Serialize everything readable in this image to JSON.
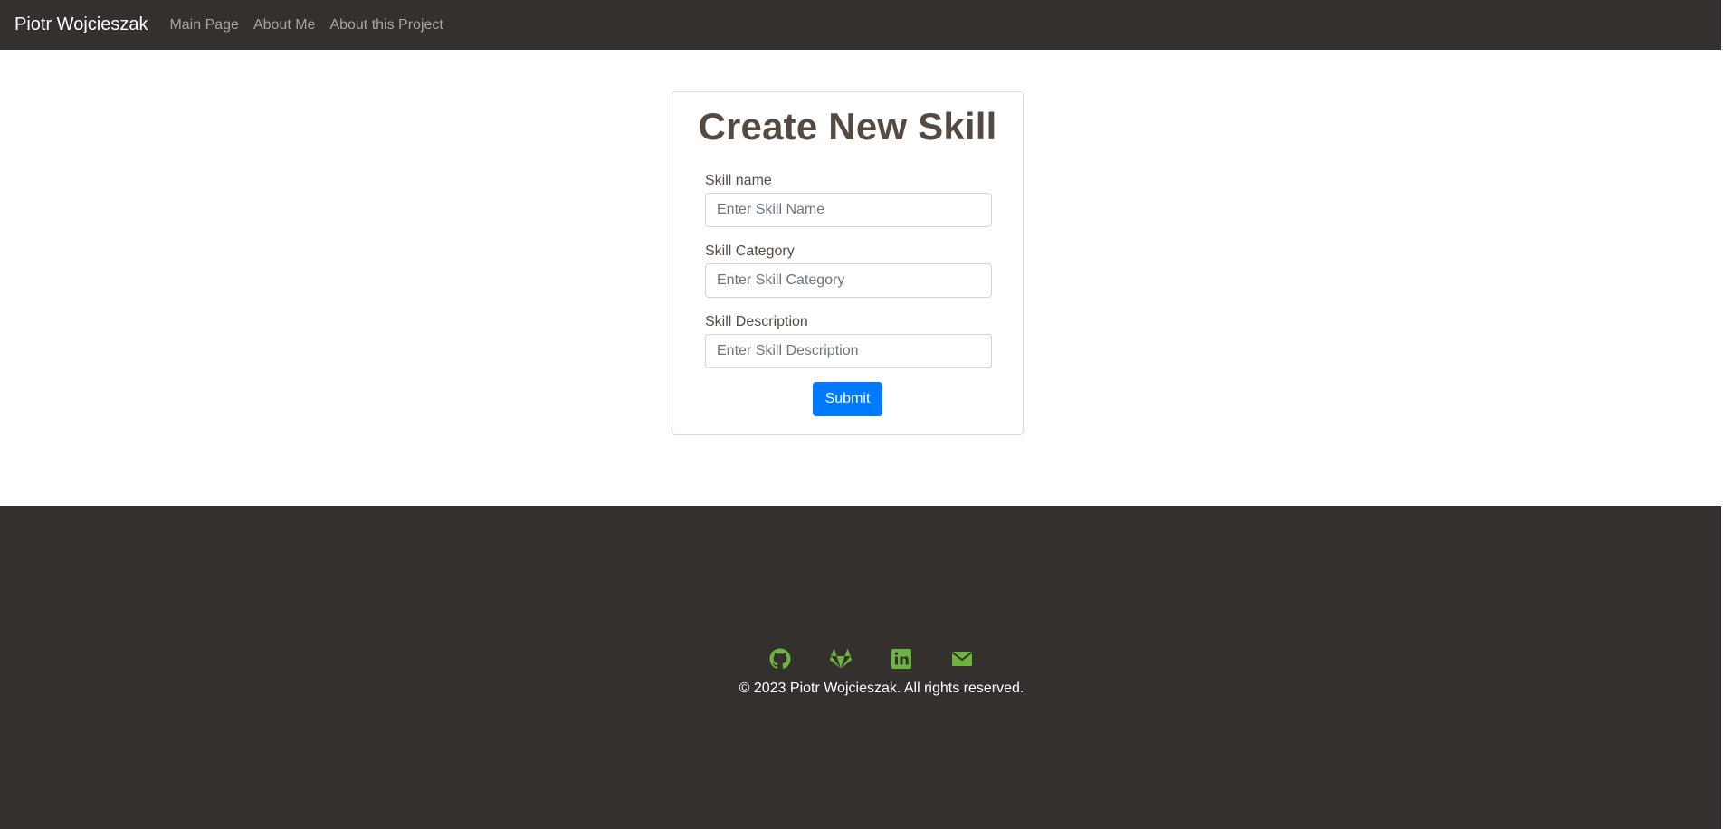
{
  "navbar": {
    "brand": "Piotr Wojcieszak",
    "links": [
      "Main Page",
      "About Me",
      "About this Project"
    ]
  },
  "form": {
    "title": "Create New Skill",
    "fields": [
      {
        "label": "Skill name",
        "placeholder": "Enter Skill Name",
        "value": ""
      },
      {
        "label": "Skill Category",
        "placeholder": "Enter Skill Category",
        "value": ""
      },
      {
        "label": "Skill Description",
        "placeholder": "Enter Skill Description",
        "value": ""
      }
    ],
    "submit_label": "Submit"
  },
  "footer": {
    "icons": [
      "github-icon",
      "gitlab-icon",
      "linkedin-icon",
      "email-icon"
    ],
    "copyright": "© 2023 Piotr Wojcieszak. All rights reserved."
  },
  "colors": {
    "navbar_bg": "#34302d",
    "footer_bg": "#34302d",
    "icon_accent": "#6db33f",
    "button_primary": "#007bff",
    "title_text": "#544a42"
  }
}
